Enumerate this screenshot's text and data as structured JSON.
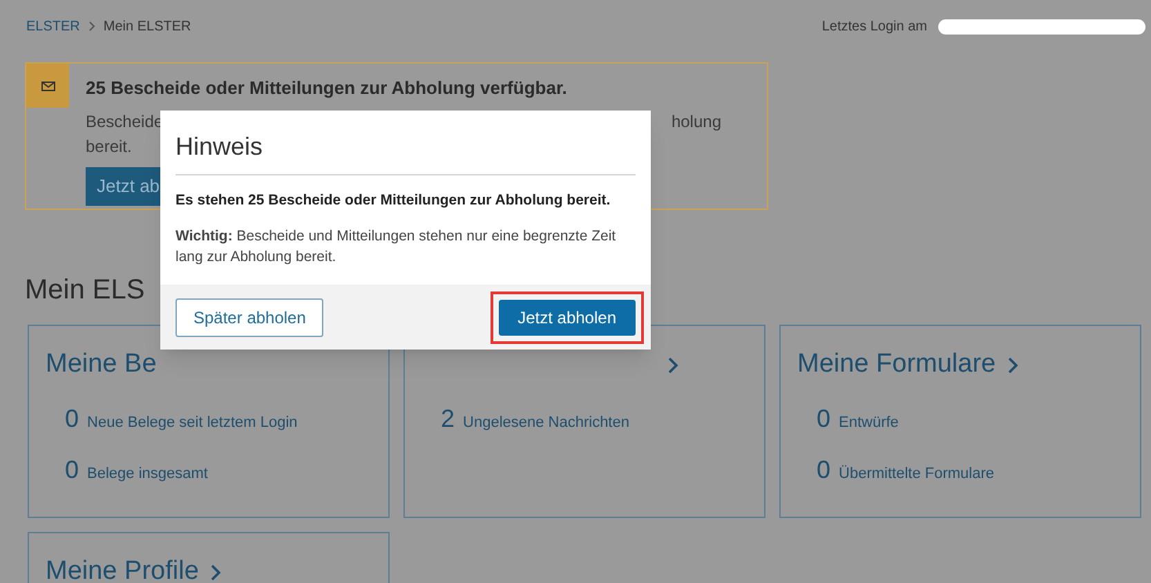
{
  "breadcrumb": [
    {
      "label": "ELSTER",
      "kind": "link"
    },
    {
      "label": "Mein ELSTER",
      "kind": "current"
    }
  ],
  "last_login": {
    "label": "Letztes Login am"
  },
  "notice": {
    "title": "25 Bescheide oder Mitteilungen zur Abholung verfügbar.",
    "text_start": "Bescheide",
    "text_end": "holung",
    "text_line2": "bereit.",
    "button": "Jetzt ab"
  },
  "heading": "Mein ELS",
  "cards": [
    {
      "title": "Meine Be",
      "chevron": false,
      "items": [
        {
          "count": "0",
          "label": "Neue Belege seit letztem Login"
        },
        {
          "count": "0",
          "label": "Belege insgesamt"
        }
      ]
    },
    {
      "chevron": true,
      "items": [
        {
          "count": "2",
          "label": "Ungelesene Nachrichten"
        }
      ]
    },
    {
      "title": "Meine Formulare",
      "chevron": true,
      "items": [
        {
          "count": "0",
          "label": "Entwürfe"
        },
        {
          "count": "0",
          "label": "Übermittelte Formulare"
        }
      ]
    },
    {
      "title": "Meine Profile",
      "chevron": true
    }
  ],
  "modal": {
    "title": "Hinweis",
    "message": "Es stehen 25 Bescheide oder Mitteilungen zur Abholung bereit.",
    "note": "**Wichtig:** Bescheide und Mitteilungen stehen nur eine begrenzte Zeit lang zur Abholung bereit.",
    "buttons": [
      {
        "label": "Später abholen",
        "kind": "secondary",
        "highlighted": false
      },
      {
        "label": "Jetzt abholen",
        "kind": "primary",
        "highlighted": true
      }
    ]
  }
}
